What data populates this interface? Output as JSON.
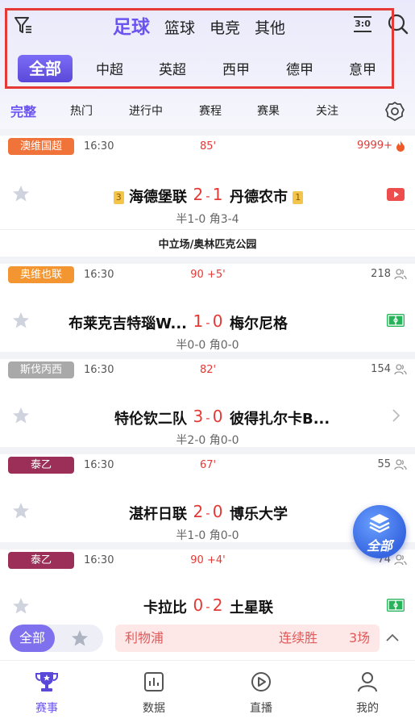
{
  "sport_tabs": [
    "足球",
    "篮球",
    "电竞",
    "其他"
  ],
  "score_icon_text": "3:0",
  "league_tabs": [
    "全部",
    "中超",
    "英超",
    "西甲",
    "德甲",
    "意甲"
  ],
  "filter_tabs": [
    "完整",
    "热门",
    "进行中",
    "赛程",
    "赛果",
    "关注"
  ],
  "matches": [
    {
      "league": "澳维国超",
      "league_color": "#f0743a",
      "time": "16:30",
      "minute": "85'",
      "count": "9999+",
      "home": "海德堡联",
      "home_rank": "3",
      "home_score": "2",
      "away_score": "1",
      "away": "丹德农市",
      "away_rank": "1",
      "half": "半1-0 角3-4",
      "venue": "中立场/奥林匹克公园",
      "icon": "video-icon"
    },
    {
      "league": "奥维也联",
      "league_color": "#f39631",
      "time": "16:30",
      "minute": "90 +5'",
      "count": "218",
      "home": "布莱克吉特瑙W...",
      "home_score": "1",
      "away_score": "0",
      "away": "梅尔尼格",
      "half": "半0-0 角0-0",
      "icon": "field-icon"
    },
    {
      "league": "斯伐丙西",
      "league_color": "#a9a9a9",
      "time": "16:30",
      "minute": "82'",
      "count": "154",
      "home": "特伦钦二队",
      "home_score": "3",
      "away_score": "0",
      "away": "彼得扎尔卡B...",
      "half": "半2-0 角0-0",
      "icon": "chevron-right-icon"
    },
    {
      "league": "泰乙",
      "league_color": "#9b2f58",
      "time": "16:30",
      "minute": "67'",
      "count": "55",
      "home": "湛杆日联",
      "home_score": "2",
      "away_score": "0",
      "away": "博乐大学",
      "half": "半1-0 角0-0"
    },
    {
      "league": "泰乙",
      "league_color": "#9b2f58",
      "time": "16:30",
      "minute": "90 +4'",
      "count": "74",
      "home": "卡拉比",
      "home_score": "0",
      "away_score": "2",
      "away": "土星联",
      "icon": "field-icon"
    }
  ],
  "fab_label": "全部",
  "bottom_filter": {
    "all": "全部",
    "promo_team": "利物浦",
    "promo_label": "连续胜",
    "promo_count": "3场"
  },
  "tabbar": [
    "赛事",
    "数据",
    "直播",
    "我的"
  ],
  "colors": {
    "accent": "#6a54f0",
    "score": "#e53935",
    "highlight_box": "#e53935"
  }
}
